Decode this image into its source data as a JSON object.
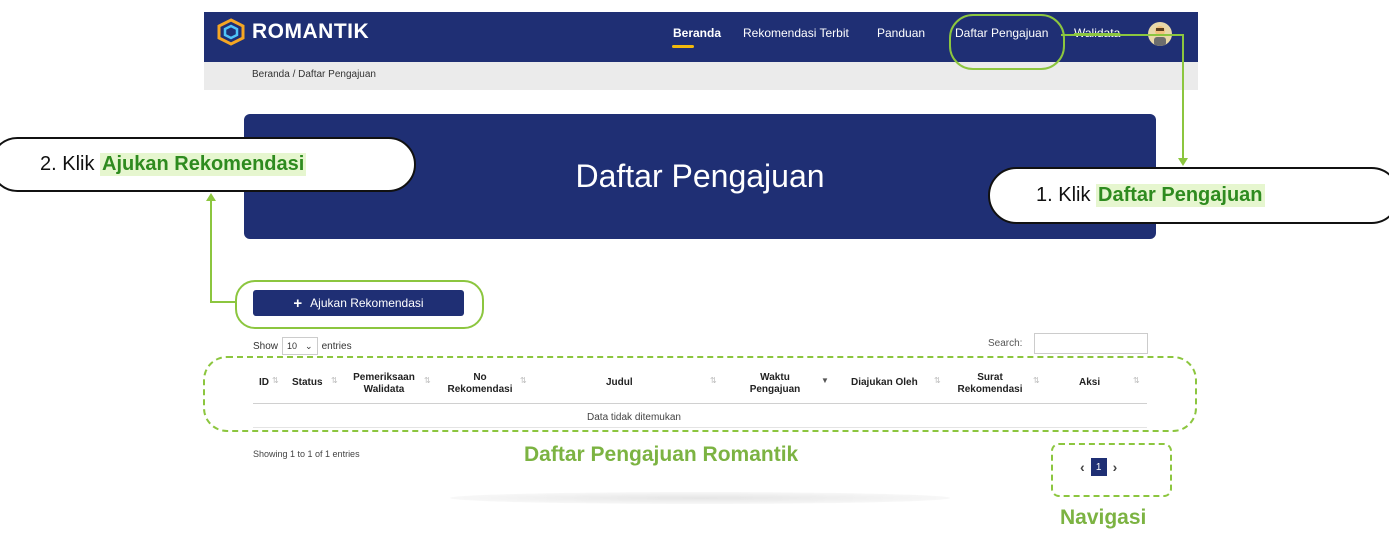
{
  "app": {
    "logo_text": "ROMANTIK"
  },
  "nav": {
    "items": [
      "Beranda",
      "Rekomendasi Terbit",
      "Panduan",
      "Daftar Pengajuan",
      "Walidata"
    ]
  },
  "breadcrumb": "Beranda / Daftar Pengajuan",
  "hero": {
    "title": "Daftar Pengajuan"
  },
  "add_button": {
    "label": "Ajukan Rekomendasi"
  },
  "table_controls": {
    "show_label": "Show",
    "show_value": "10",
    "entries_label": "entries",
    "search_label": "Search:"
  },
  "table": {
    "columns": [
      "ID",
      "Status",
      "Pemeriksaan Walidata",
      "No Rekomendasi",
      "Judul",
      "Waktu Pengajuan",
      "Diajukan Oleh",
      "Surat Rekomendasi",
      "Aksi"
    ],
    "empty_text": "Data tidak ditemukan",
    "info": "Showing 1 to 1 of 1 entries"
  },
  "pagination": {
    "prev": "‹",
    "page": "1",
    "next": "›"
  },
  "annotations": {
    "step1_prefix": "1. Klik ",
    "step1_highlight": "Daftar Pengajuan",
    "step2_prefix": "2. Klik ",
    "step2_highlight": "Ajukan Rekomendasi",
    "table_label": "Daftar Pengajuan Romantik",
    "nav_label": "Navigasi"
  },
  "colors": {
    "primary": "#1f2f74",
    "accent_green": "#8cc63f",
    "nav_underline": "#f2b90c"
  }
}
